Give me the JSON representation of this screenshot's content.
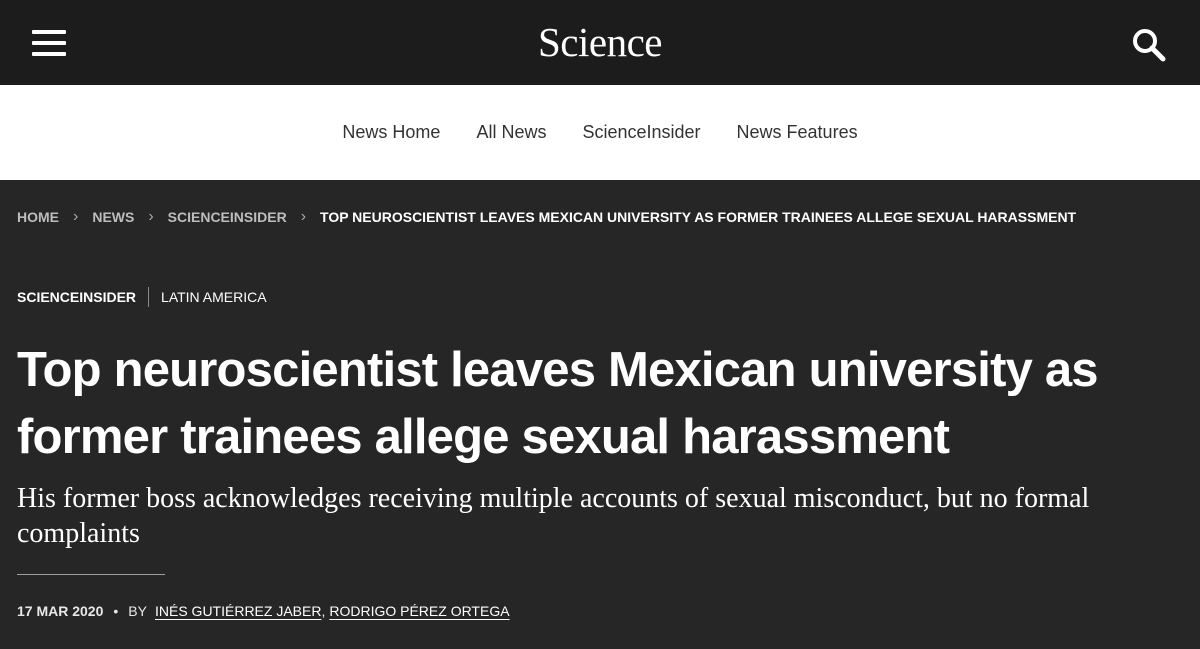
{
  "header": {
    "logo": "Science",
    "menu_icon": "hamburger-menu-icon",
    "search_icon": "search-icon"
  },
  "subnav": {
    "items": [
      {
        "label": "News Home"
      },
      {
        "label": "All News"
      },
      {
        "label": "ScienceInsider"
      },
      {
        "label": "News Features"
      }
    ]
  },
  "breadcrumb": {
    "items": [
      {
        "label": "HOME"
      },
      {
        "label": "NEWS"
      },
      {
        "label": "SCIENCEINSIDER"
      }
    ],
    "current": "TOP NEUROSCIENTIST LEAVES MEXICAN UNIVERSITY AS FORMER TRAINEES ALLEGE SEXUAL HARASSMENT"
  },
  "article": {
    "section": "SCIENCEINSIDER",
    "region": "LATIN AMERICA",
    "title": "Top neuroscientist leaves Mexican university as former trainees allege sexual harassment",
    "dek": "His former boss acknowledges receiving multiple accounts of sexual misconduct, but no formal complaints",
    "date": "17 MAR 2020",
    "byline_prefix": "BY",
    "authors": [
      "INÉS GUTIÉRREZ JABER",
      "RODRIGO PÉREZ ORTEGA"
    ],
    "author_separator": ","
  },
  "colors": {
    "topbar": "#1c1c1c",
    "subnav": "#ffffff",
    "content": "#262626",
    "text": "#ffffff"
  }
}
